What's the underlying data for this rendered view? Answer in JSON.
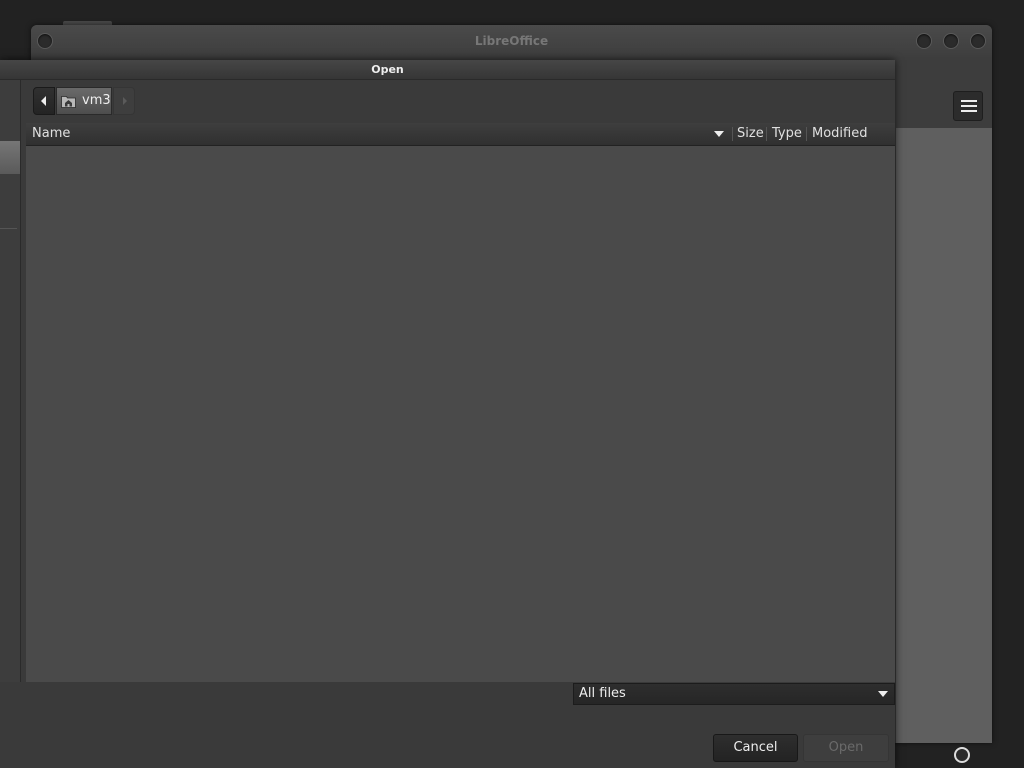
{
  "main_window": {
    "title": "LibreOffice",
    "menu_icon": "hamburger-menu-icon",
    "status_icon": "status-indicator-icon"
  },
  "dialog": {
    "title": "Open",
    "path_bar": {
      "back_icon": "back-arrow-icon",
      "forward_icon": "forward-arrow-icon",
      "current_folder": {
        "icon": "home-folder-icon",
        "label": "vm3"
      }
    },
    "file_list": {
      "columns": [
        "Name",
        "Size",
        "Type",
        "Modified"
      ],
      "sort_column": "Name",
      "rows": []
    },
    "filter": {
      "selected": "All files"
    },
    "buttons": {
      "cancel": "Cancel",
      "open": "Open"
    }
  },
  "colors": {
    "desktop_bg": "#222222",
    "dialog_bg": "#3a3a3a",
    "file_list_bg": "#4a4a4a",
    "side_panel": "#5f5f5f",
    "text": "#eeeeee",
    "disabled_text": "#6a6a6a"
  }
}
